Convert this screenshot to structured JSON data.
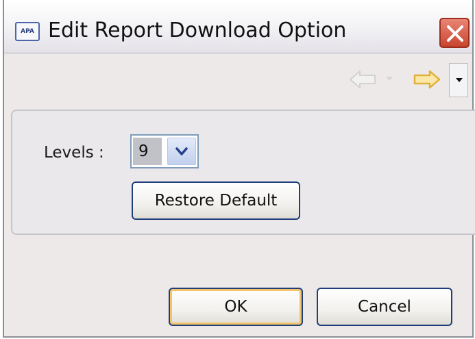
{
  "window": {
    "title": "Edit Report Download Option",
    "app_icon_text": "APA",
    "icons": {
      "app": "apa-app-icon",
      "close": "close-icon",
      "back": "back-arrow-icon",
      "forward": "forward-arrow-icon",
      "dropdown": "chevron-down-icon"
    },
    "colors": {
      "close_button": "#d2563f",
      "forward_arrow": "#f0c24a",
      "back_arrow": "#d9d9d9",
      "button_border": "#1f3f7a"
    }
  },
  "form": {
    "levels_label": "Levels :",
    "levels_value": "9",
    "restore_default_label": "Restore Default"
  },
  "footer": {
    "ok_label": "OK",
    "cancel_label": "Cancel"
  }
}
